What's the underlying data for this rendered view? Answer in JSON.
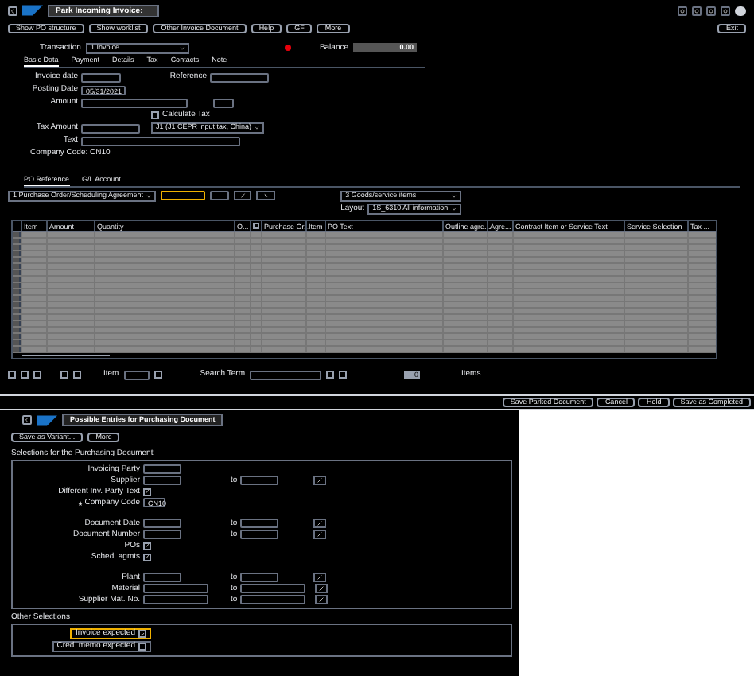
{
  "header": {
    "title": "Park Incoming Invoice:"
  },
  "toolbar": [
    "Show PO structure",
    "Show worklist",
    "Other Invoice Document",
    "Help",
    "GF",
    "More"
  ],
  "exit": "Exit",
  "transaction": {
    "label": "Transaction",
    "value": "1 Invoice"
  },
  "balance": {
    "label": "Balance",
    "value": "0.00"
  },
  "tabs": [
    {
      "label": "Basic Data",
      "selected": true
    },
    {
      "label": "Payment",
      "selected": false
    },
    {
      "label": "Details",
      "selected": false
    },
    {
      "label": "Tax",
      "selected": false
    },
    {
      "label": "Contacts",
      "selected": false
    },
    {
      "label": "Note",
      "selected": false
    }
  ],
  "form": {
    "invoice_date": "Invoice date",
    "reference": "Reference",
    "posting_date": {
      "label": "Posting Date",
      "value": "05/31/2021"
    },
    "amount": "Amount",
    "calculate_tax": {
      "label": "Calculate Tax",
      "checked": false
    },
    "tax_amount": "Tax Amount",
    "tax_code": "J1 (J1 CEPR input tax, China)",
    "text": "Text",
    "company_code": "Company Code: CN10"
  },
  "ref_tabs": [
    {
      "label": "PO Reference",
      "selected": true
    },
    {
      "label": "G/L Account",
      "selected": false
    }
  ],
  "ref_select": "1 Purchase Order/Scheduling Agreement",
  "item_select": "3 Goods/service items",
  "layout": {
    "label": "Layout",
    "value": "1S_6310 All information"
  },
  "table": {
    "columns": [
      "Item",
      "Amount",
      "Quantity",
      "O...",
      "Purchase Or...",
      "Item",
      "PO Text",
      "Outline agre...",
      "Agre...",
      "Contract Item or Service Text",
      "Service Selection",
      "Tax ..."
    ]
  },
  "table_footer": {
    "item_label": "Item",
    "search_label": "Search Term",
    "count": "0",
    "items_label": "Items"
  },
  "actions": [
    "Save Parked Document",
    "Cancel",
    "Hold",
    "Save as Completed"
  ],
  "dialog": {
    "title": "Possible Entries for Purchasing Document",
    "buttons": [
      "Save as Variant...",
      "More"
    ],
    "group1": "Selections for the Purchasing Document",
    "fields": [
      {
        "kind": "single",
        "label": "Invoicing Party"
      },
      {
        "kind": "range",
        "label": "Supplier",
        "to": "to"
      },
      {
        "kind": "check",
        "label": "Different Inv. Party Text",
        "checked": true
      },
      {
        "kind": "value",
        "label": "Company Code",
        "value": "CN10",
        "required": true
      },
      {
        "kind": "gap"
      },
      {
        "kind": "range",
        "label": "Document Date",
        "to": "to"
      },
      {
        "kind": "range",
        "label": "Document Number",
        "to": "to"
      },
      {
        "kind": "check",
        "label": "POs",
        "checked": true
      },
      {
        "kind": "check",
        "label": "Sched. agmts",
        "checked": true
      },
      {
        "kind": "gap"
      },
      {
        "kind": "range",
        "label": "Plant",
        "to": "to"
      },
      {
        "kind": "range",
        "label": "Material",
        "to": "to"
      },
      {
        "kind": "range",
        "label": "Supplier Mat. No.",
        "to": "to"
      }
    ],
    "group2": "Other Selections",
    "other": [
      {
        "label": "Invoice expected",
        "checked": true,
        "selected": true
      },
      {
        "label": "Cred. memo expected",
        "checked": false,
        "selected": false
      }
    ]
  }
}
